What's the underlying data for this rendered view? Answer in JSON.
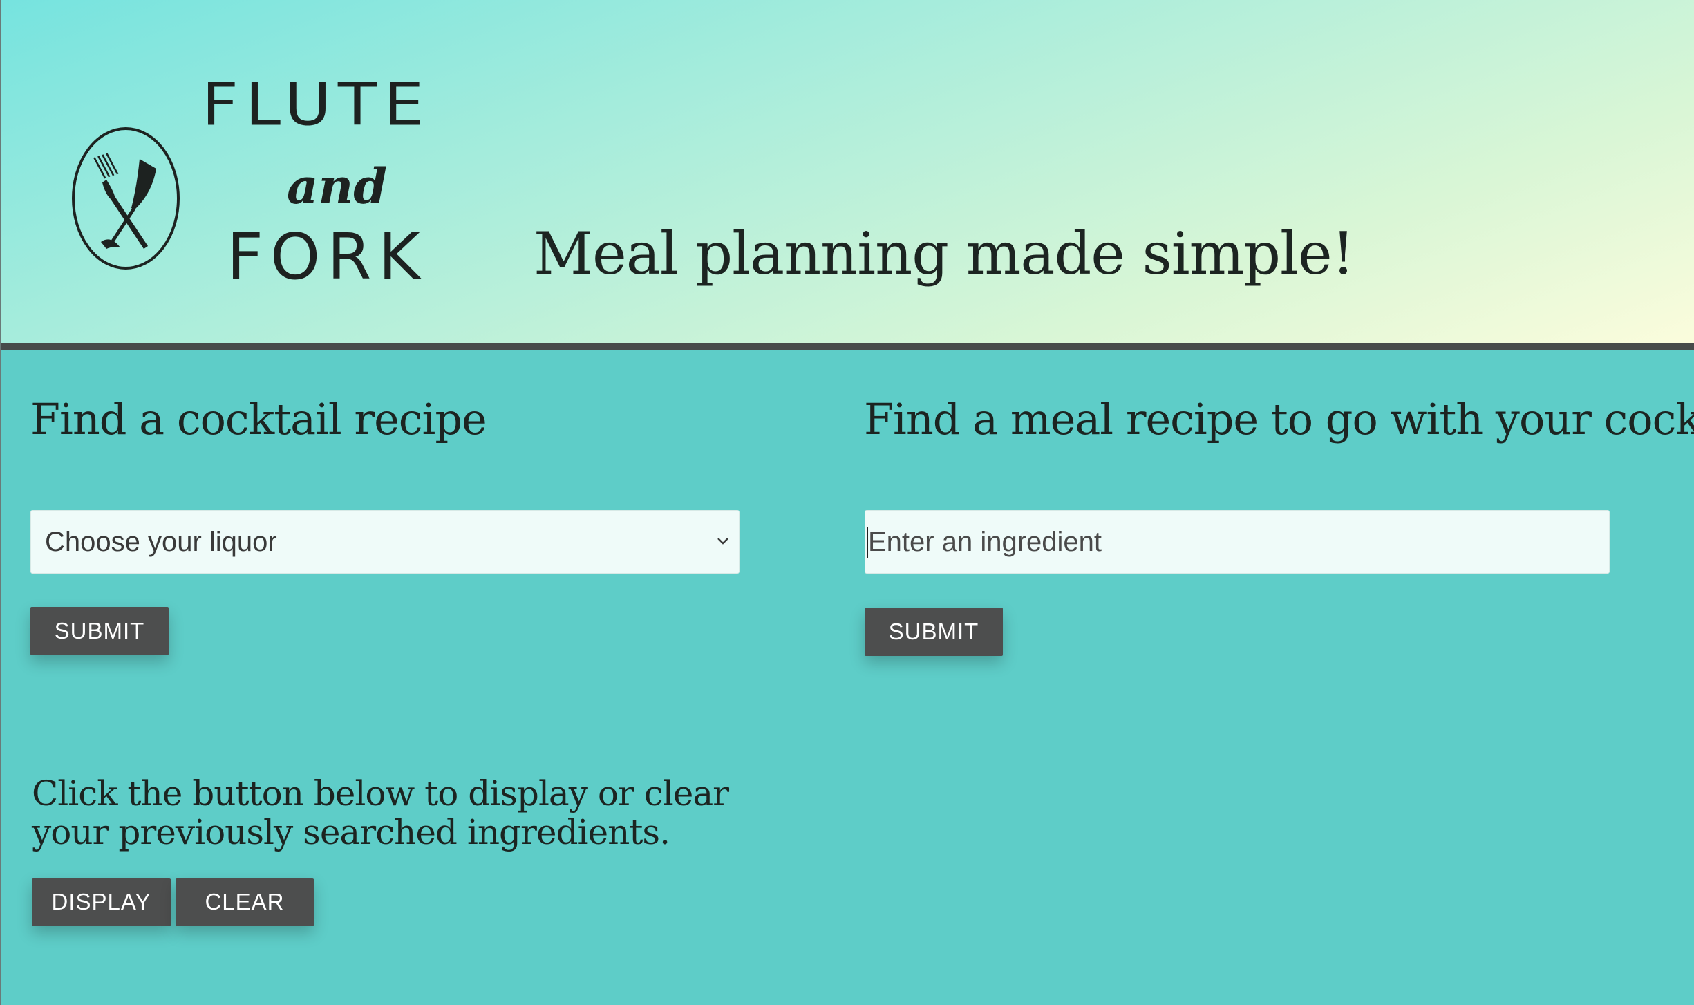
{
  "header": {
    "logo": {
      "line1": "flute",
      "line2": "and",
      "line3": "fork"
    },
    "tagline": "Meal planning made simple!"
  },
  "cocktail": {
    "heading": "Find a cocktail recipe",
    "select_value": "Choose your liquor",
    "submit_label": "SUBMIT"
  },
  "meal": {
    "heading": "Find a meal recipe to go with your cocktail",
    "input_placeholder": "Enter an ingredient",
    "submit_label": "SUBMIT"
  },
  "history": {
    "text": "Click the button below to display or clear your previously searched ingredients.",
    "display_label": "DISPLAY",
    "clear_label": "CLEAR"
  },
  "colors": {
    "main_background": "#5ecdc8",
    "button": "#4d4e4e",
    "input_background": "#effbf9",
    "header_rule": "#474b4a"
  },
  "icons": {
    "logo": "fork-and-champagne-flute-emblem",
    "select": "chevron-down-icon"
  }
}
